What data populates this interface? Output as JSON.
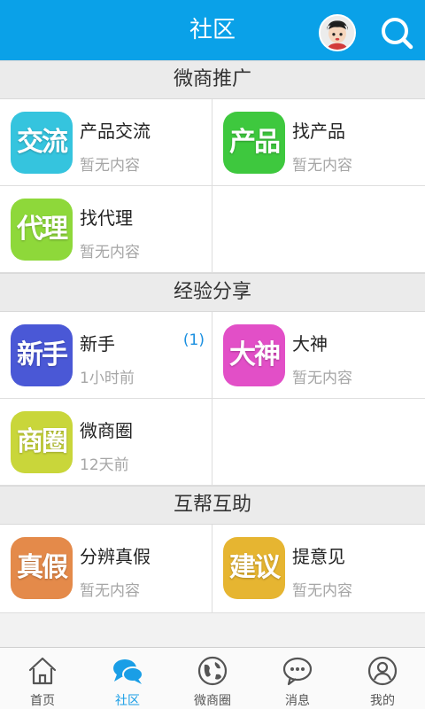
{
  "header": {
    "title": "社区",
    "avatar_icon": "user-avatar",
    "search_icon": "search-icon"
  },
  "sections": [
    {
      "title": "微商推广",
      "items": [
        {
          "icon_text": "交流",
          "icon_color": "#35c4de",
          "name": "产品交流",
          "sub": "暂无内容"
        },
        {
          "icon_text": "产品",
          "icon_color": "#3ec83e",
          "name": "找产品",
          "sub": "暂无内容"
        },
        {
          "icon_text": "代理",
          "icon_color": "#8ed83a",
          "name": "找代理",
          "sub": "暂无内容"
        }
      ]
    },
    {
      "title": "经验分享",
      "items": [
        {
          "icon_text": "新手",
          "icon_color": "#4a58d6",
          "name": "新手",
          "sub": "1小时前",
          "badge": "(1)"
        },
        {
          "icon_text": "大神",
          "icon_color": "#e24fc7",
          "name": "大神",
          "sub": "暂无内容"
        },
        {
          "icon_text": "商圈",
          "icon_color": "#c9d63a",
          "name": "微商圈",
          "sub": "12天前"
        }
      ]
    },
    {
      "title": "互帮互助",
      "items": [
        {
          "icon_text": "真假",
          "icon_color": "#e48a4a",
          "name": "分辨真假",
          "sub": "暂无内容"
        },
        {
          "icon_text": "建议",
          "icon_color": "#e6b531",
          "name": "提意见",
          "sub": "暂无内容"
        }
      ]
    }
  ],
  "tabbar": [
    {
      "label": "首页",
      "icon": "home-icon"
    },
    {
      "label": "社区",
      "icon": "chat-bubbles-icon",
      "active": true
    },
    {
      "label": "微商圈",
      "icon": "globe-icon"
    },
    {
      "label": "消息",
      "icon": "message-icon"
    },
    {
      "label": "我的",
      "icon": "profile-icon"
    }
  ],
  "colors": {
    "accent": "#0aa1e8",
    "tab_active": "#1a9ee6"
  }
}
